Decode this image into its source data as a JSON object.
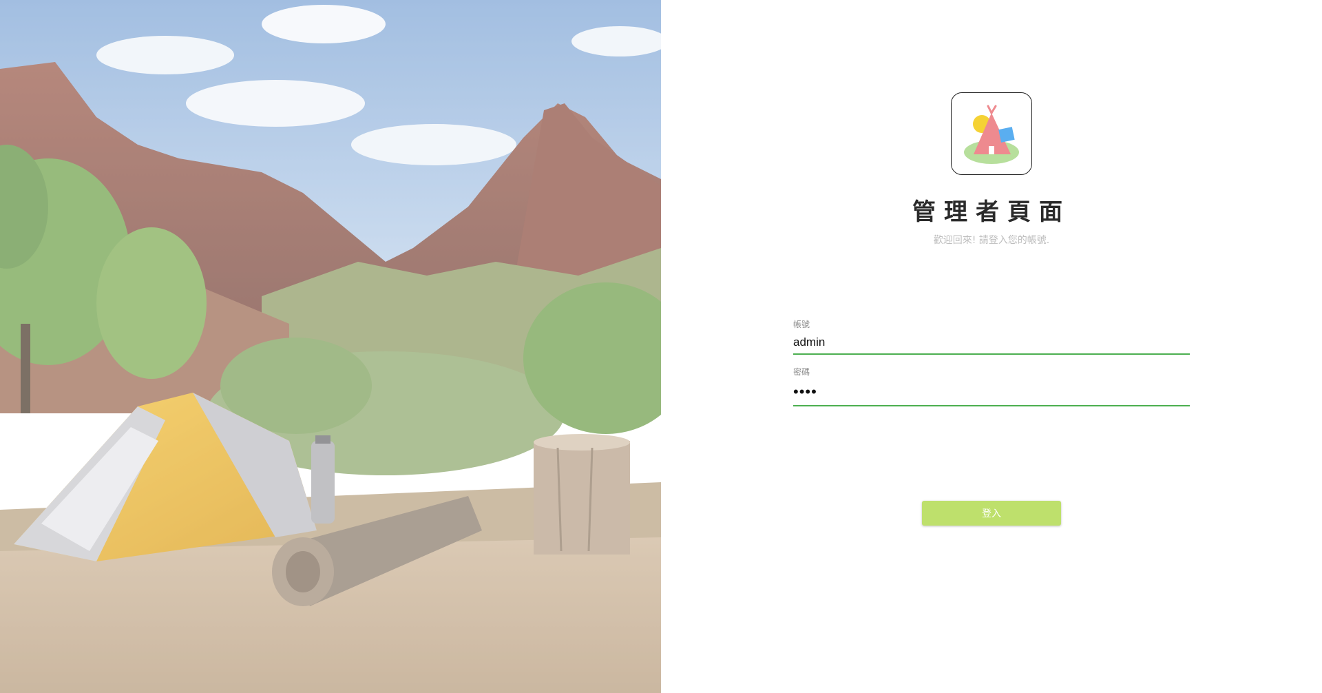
{
  "hero": {
    "image": "camping-tent-mountain-photo"
  },
  "brand": {
    "logo_icon": "tent-logo-icon",
    "colors": {
      "sun": "#f5d234",
      "tent": "#ee8a8f",
      "flag": "#5aaef0",
      "ground": "#b7df9c"
    }
  },
  "header": {
    "title": "管理者頁面",
    "subtitle": "歡迎回來! 請登入您的帳號."
  },
  "form": {
    "username": {
      "label": "帳號",
      "value": "admin"
    },
    "password": {
      "label": "密碼",
      "value": "••••"
    },
    "submit_label": "登入"
  },
  "colors": {
    "accent": "#4caf50",
    "button": "#bee06c",
    "subtitle": "#bdbdbd"
  }
}
